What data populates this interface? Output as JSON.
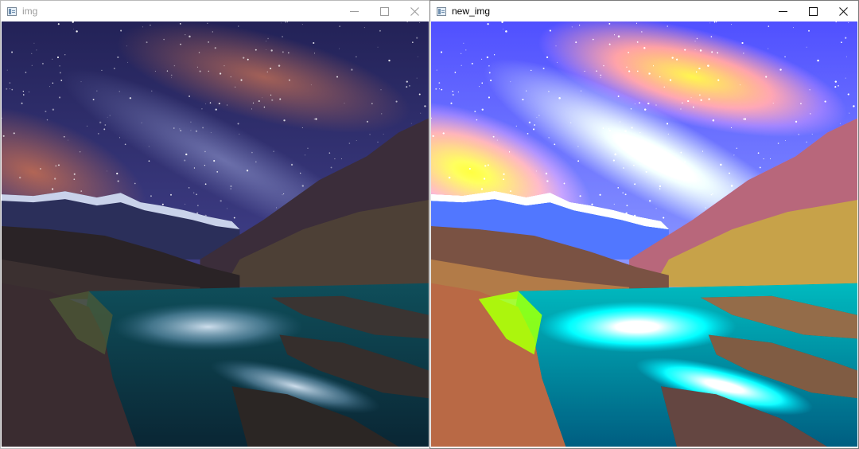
{
  "windows": {
    "left": {
      "title": "img"
    },
    "right": {
      "title": "new_img"
    }
  },
  "icons": {
    "app": "opencv-window-icon",
    "minimize": "minimize-icon",
    "maximize": "maximize-icon",
    "close": "close-icon"
  },
  "colors": {
    "sky_left": "#2c2a66",
    "glow_left": "#b86a55",
    "sky_right": "#7c88c8",
    "glow_right": "#f2a45a"
  }
}
